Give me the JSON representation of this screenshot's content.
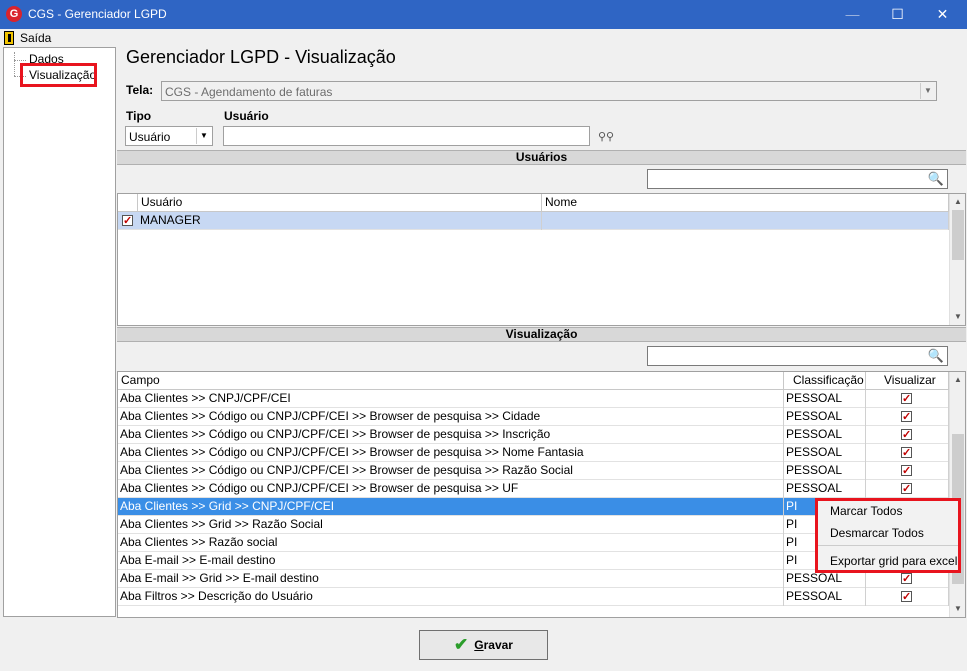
{
  "window": {
    "title": "CGS - Gerenciador LGPD",
    "app_icon_letter": "G",
    "minimize": "—",
    "maximize": "☐",
    "close": "✕"
  },
  "menu": {
    "exit_label": "Saída"
  },
  "tree": {
    "items": [
      {
        "label": "Dados"
      },
      {
        "label": "Visualização"
      }
    ]
  },
  "main": {
    "title": "Gerenciador LGPD - Visualização",
    "tela_label": "Tela:",
    "tela_value": "CGS - Agendamento de faturas",
    "tipo_label": "Tipo",
    "tipo_value": "Usuário",
    "usuario_label": "Usuário",
    "usuario_value": ""
  },
  "usuarios_section": {
    "title": "Usuários",
    "search_value": "",
    "columns": [
      "Usuário",
      "Nome"
    ],
    "rows": [
      {
        "checked": true,
        "usuario": "MANAGER",
        "nome": ""
      }
    ]
  },
  "visualizacao_section": {
    "title": "Visualização",
    "search_value": "",
    "columns": [
      "Campo",
      "Classificação",
      "Visualizar"
    ],
    "rows": [
      {
        "campo": "Aba Clientes >> CNPJ/CPF/CEI",
        "classificacao": "PESSOAL",
        "visualizar": true
      },
      {
        "campo": "Aba Clientes >> Código ou CNPJ/CPF/CEI >> Browser de pesquisa >> Cidade",
        "classificacao": "PESSOAL",
        "visualizar": true
      },
      {
        "campo": "Aba Clientes >> Código ou CNPJ/CPF/CEI >> Browser de pesquisa >> Inscrição",
        "classificacao": "PESSOAL",
        "visualizar": true
      },
      {
        "campo": "Aba Clientes >> Código ou CNPJ/CPF/CEI >> Browser de pesquisa >> Nome Fantasia",
        "classificacao": "PESSOAL",
        "visualizar": true
      },
      {
        "campo": "Aba Clientes >> Código ou CNPJ/CPF/CEI >> Browser de pesquisa >> Razão Social",
        "classificacao": "PESSOAL",
        "visualizar": true
      },
      {
        "campo": "Aba Clientes >> Código ou CNPJ/CPF/CEI >> Browser de pesquisa >> UF",
        "classificacao": "PESSOAL",
        "visualizar": true
      },
      {
        "campo": "Aba Clientes >> Grid >> CNPJ/CPF/CEI",
        "classificacao": "PI",
        "visualizar": true
      },
      {
        "campo": "Aba Clientes >> Grid >> Razão Social",
        "classificacao": "PI",
        "visualizar": true
      },
      {
        "campo": "Aba Clientes >> Razão social",
        "classificacao": "PI",
        "visualizar": true
      },
      {
        "campo": "Aba E-mail >> E-mail destino",
        "classificacao": "PI",
        "visualizar": true
      },
      {
        "campo": "Aba E-mail >> Grid >> E-mail destino",
        "classificacao": "PESSOAL",
        "visualizar": true
      },
      {
        "campo": "Aba Filtros >> Descrição do Usuário",
        "classificacao": "PESSOAL",
        "visualizar": true
      }
    ]
  },
  "context_menu": {
    "items": [
      "Marcar Todos",
      "Desmarcar Todos",
      "Exportar grid para excel"
    ]
  },
  "footer": {
    "save_label_prefix": "",
    "save_label_underlined": "G",
    "save_label_rest": "ravar"
  },
  "colors": {
    "titlebar": "#2f65c4",
    "selection": "#3a8ee6",
    "highlight": "#e8141e",
    "checkmark": "#c00000"
  },
  "icons": [
    "app-logo-icon",
    "exit-door-icon",
    "binoculars-icon",
    "search-icon",
    "check-icon"
  ]
}
